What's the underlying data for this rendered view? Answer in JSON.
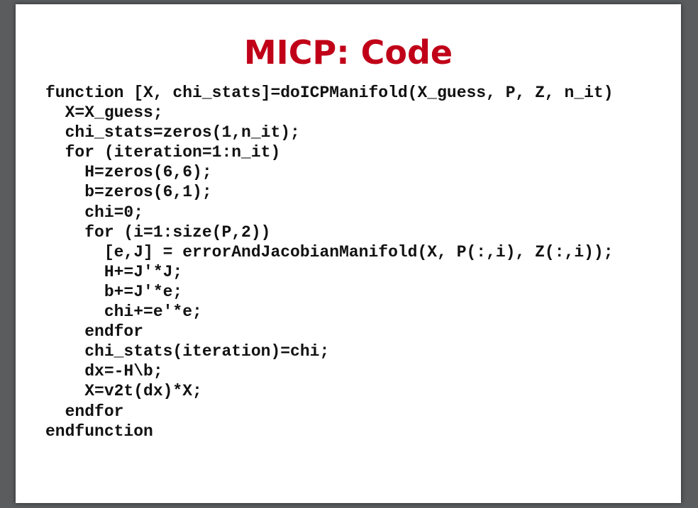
{
  "slide": {
    "title": "MICP: Code",
    "title_color": "#c00018",
    "code_lines": [
      "function [X, chi_stats]=doICPManifold(X_guess, P, Z, n_it)",
      "  X=X_guess;",
      "  chi_stats=zeros(1,n_it);",
      "  for (iteration=1:n_it)",
      "    H=zeros(6,6);",
      "    b=zeros(6,1);",
      "    chi=0;",
      "    for (i=1:size(P,2))",
      "      [e,J] = errorAndJacobianManifold(X, P(:,i), Z(:,i));",
      "      H+=J'*J;",
      "      b+=J'*e;",
      "      chi+=e'*e;",
      "    endfor",
      "    chi_stats(iteration)=chi;",
      "    dx=-H\\b;",
      "    X=v2t(dx)*X;",
      "  endfor",
      "endfunction"
    ]
  }
}
